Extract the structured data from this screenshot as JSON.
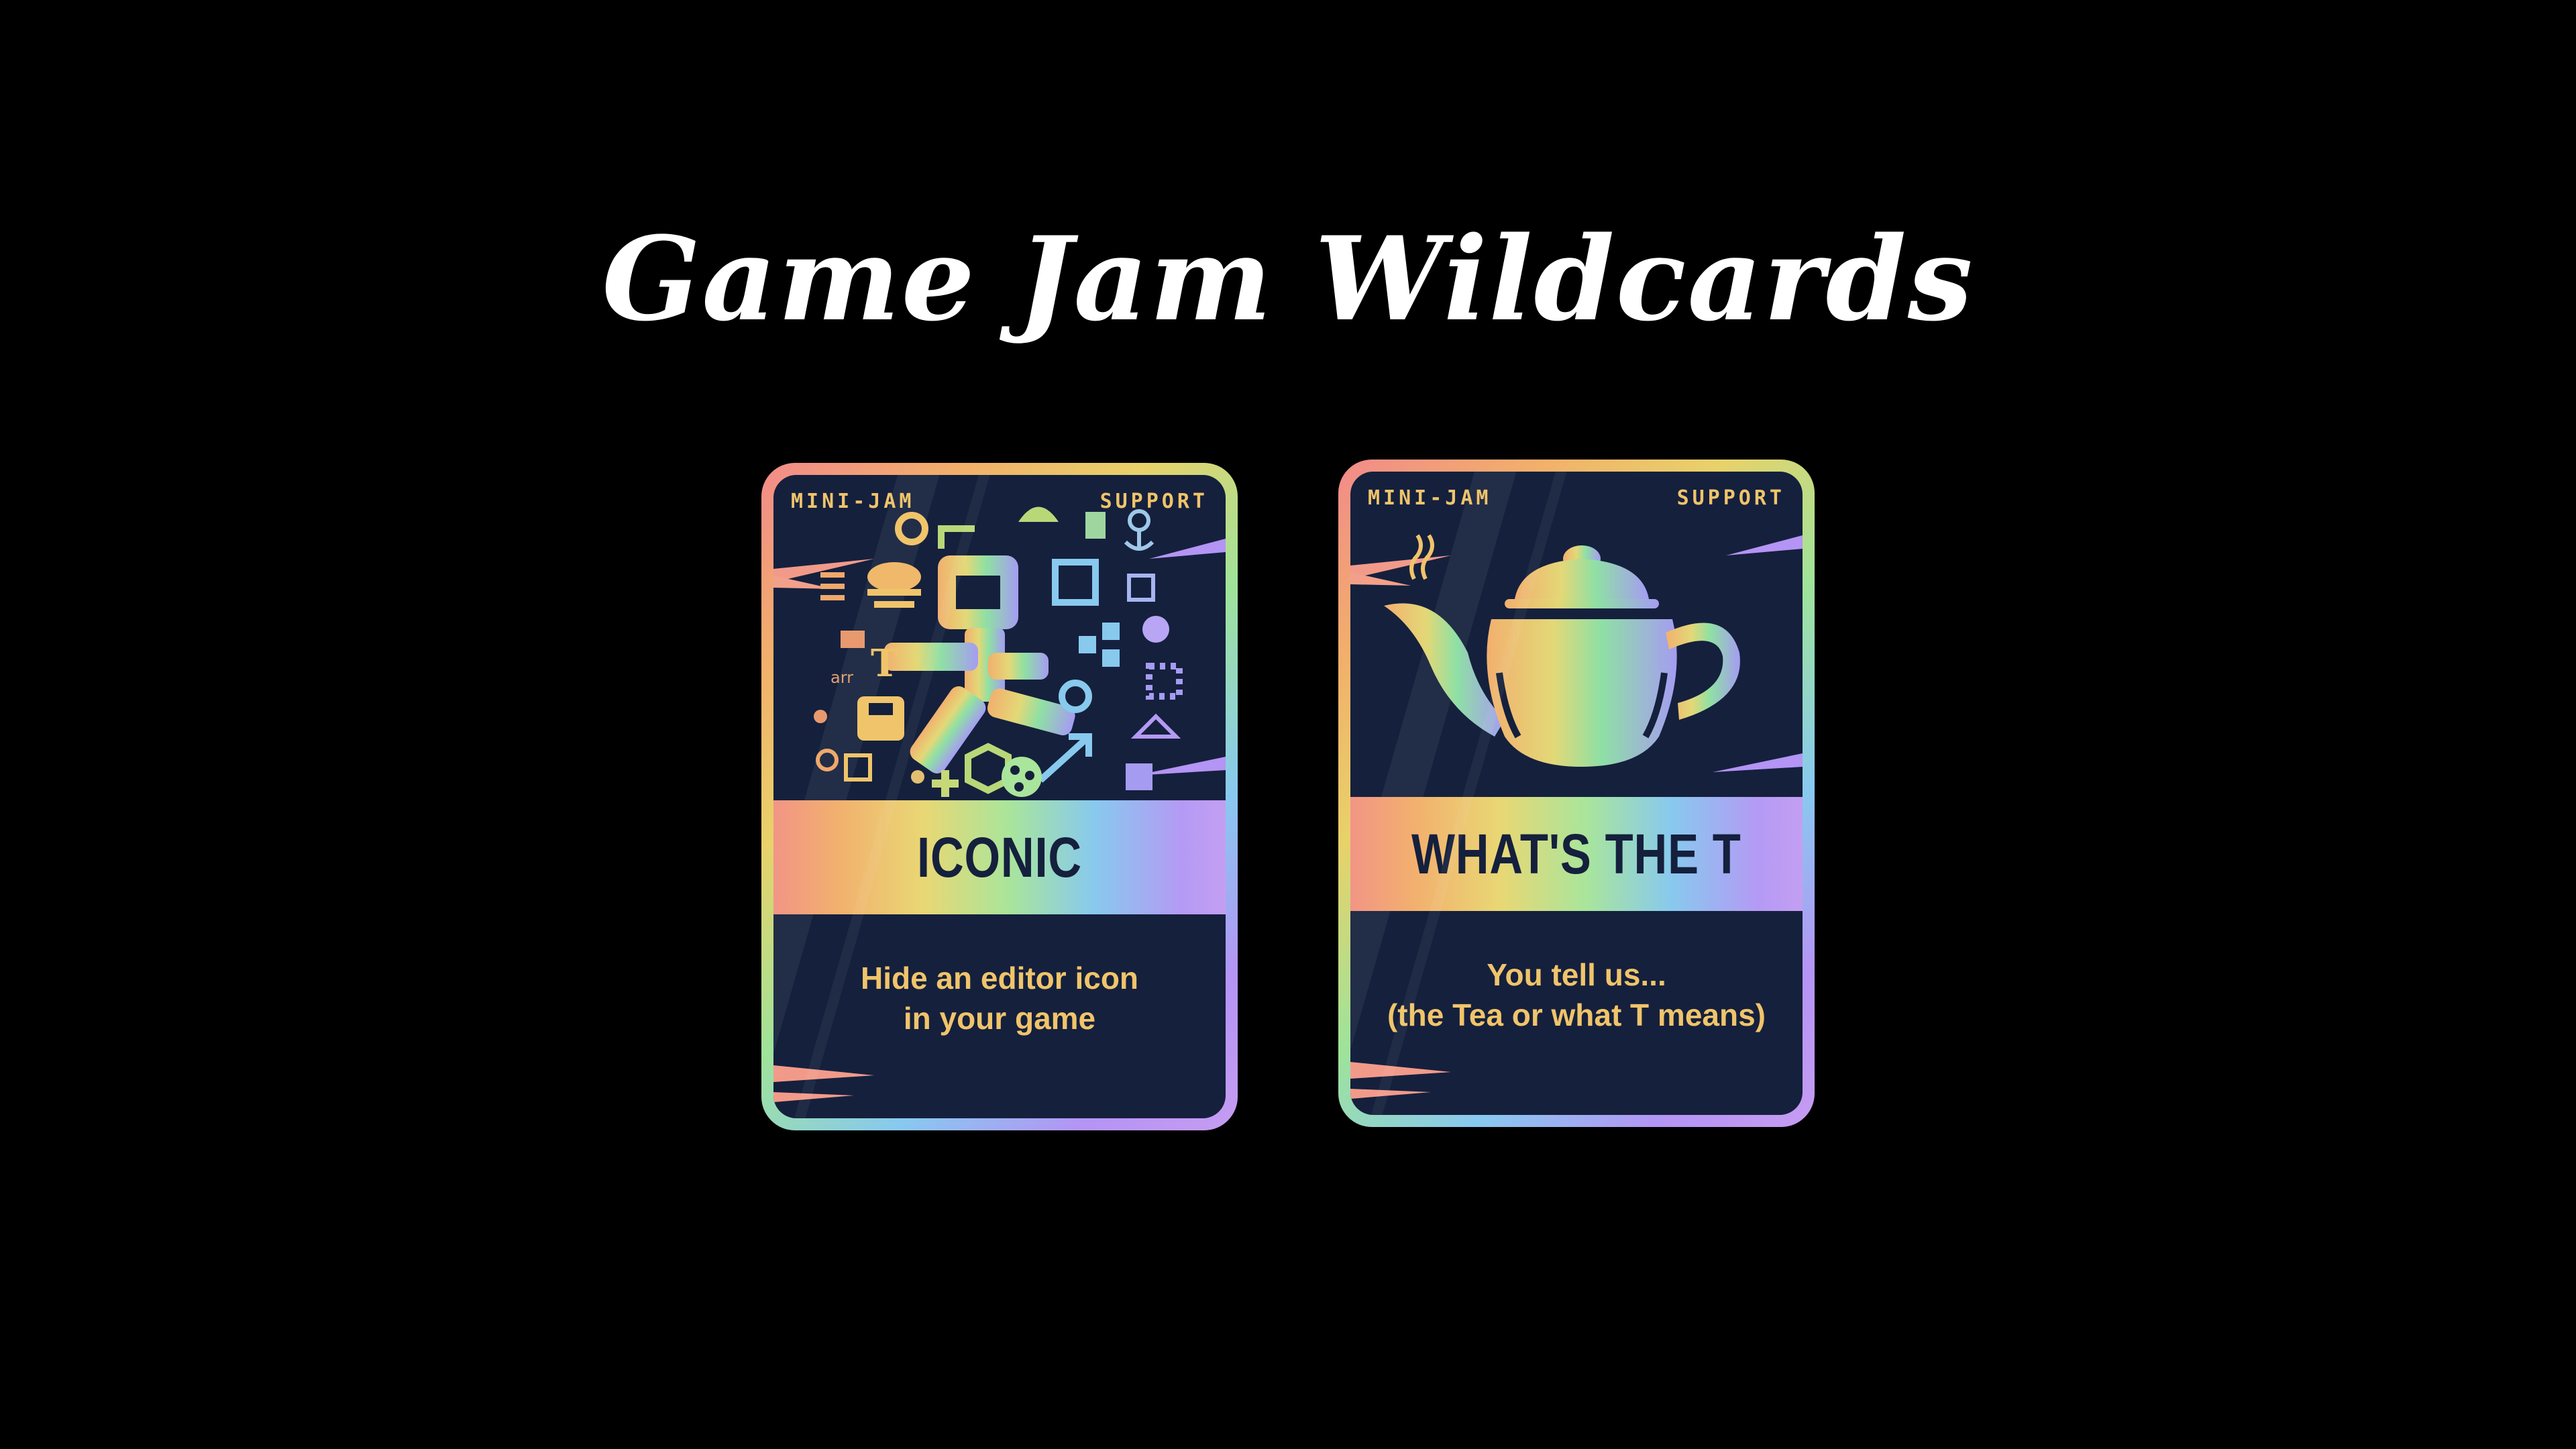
{
  "title": "Game Jam Wildcards",
  "cards": [
    {
      "tag_left": "MINI-JAM",
      "tag_right": "SUPPORT",
      "name": "ICONIC",
      "description_line1": "Hide an editor icon",
      "description_line2": "in your game",
      "art": "editor-icons-collage"
    },
    {
      "tag_left": "MINI-JAM",
      "tag_right": "SUPPORT",
      "name": "WHAT'S THE T",
      "description_line1": "You tell us...",
      "description_line2": "(the Tea or what T means)",
      "art": "teapot"
    }
  ],
  "colors": {
    "background": "#000000",
    "card_body": "#15203d",
    "accent_text": "#f0c46a"
  }
}
